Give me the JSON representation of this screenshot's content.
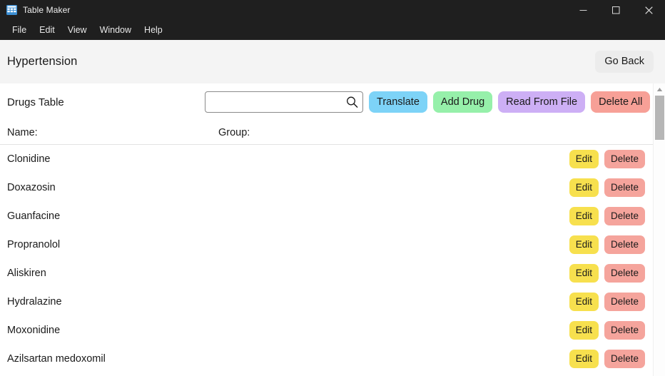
{
  "window": {
    "title": "Table Maker",
    "icon": "table-grid-icon",
    "controls": {
      "minimize": "minimize-icon",
      "maximize": "maximize-icon",
      "close": "close-icon"
    }
  },
  "menubar": {
    "items": [
      {
        "label": "File"
      },
      {
        "label": "Edit"
      },
      {
        "label": "View"
      },
      {
        "label": "Window"
      },
      {
        "label": "Help"
      }
    ]
  },
  "header": {
    "title": "Hypertension",
    "go_back_label": "Go Back"
  },
  "toolbar": {
    "table_label": "Drugs Table",
    "search": {
      "value": "",
      "placeholder": "",
      "icon": "search-icon"
    },
    "buttons": [
      {
        "label": "Translate",
        "name": "translate-button",
        "color": "#7dd3f7"
      },
      {
        "label": "Add Drug",
        "name": "add-drug-button",
        "color": "#96f0aa"
      },
      {
        "label": "Read From File",
        "name": "read-from-file-button",
        "color": "#cdaff5"
      },
      {
        "label": "Delete All",
        "name": "delete-all-button",
        "color": "#f7a097"
      }
    ]
  },
  "table": {
    "columns": {
      "name": "Name:",
      "group": "Group:"
    },
    "row_actions": {
      "edit": "Edit",
      "delete": "Delete"
    },
    "rows": [
      {
        "name": "Clonidine",
        "group": ""
      },
      {
        "name": "Doxazosin",
        "group": ""
      },
      {
        "name": "Guanfacine",
        "group": ""
      },
      {
        "name": "Propranolol",
        "group": ""
      },
      {
        "name": "Aliskiren",
        "group": ""
      },
      {
        "name": "Hydralazine",
        "group": ""
      },
      {
        "name": "Moxonidine",
        "group": ""
      },
      {
        "name": "Azilsartan medoxomil",
        "group": ""
      }
    ]
  },
  "scrollbar": {
    "up_arrow": "scroll-up-arrow-icon",
    "thumb": "scrollbar-thumb"
  },
  "colors": {
    "titlebar_bg": "#1f1f1f",
    "header_bg": "#f4f4f4",
    "accent_translate": "#7dd3f7",
    "accent_add": "#96f0aa",
    "accent_read": "#cdaff5",
    "accent_delete": "#f7a097",
    "accent_edit": "#f7e04e",
    "accent_row_delete": "#f5a49c"
  }
}
